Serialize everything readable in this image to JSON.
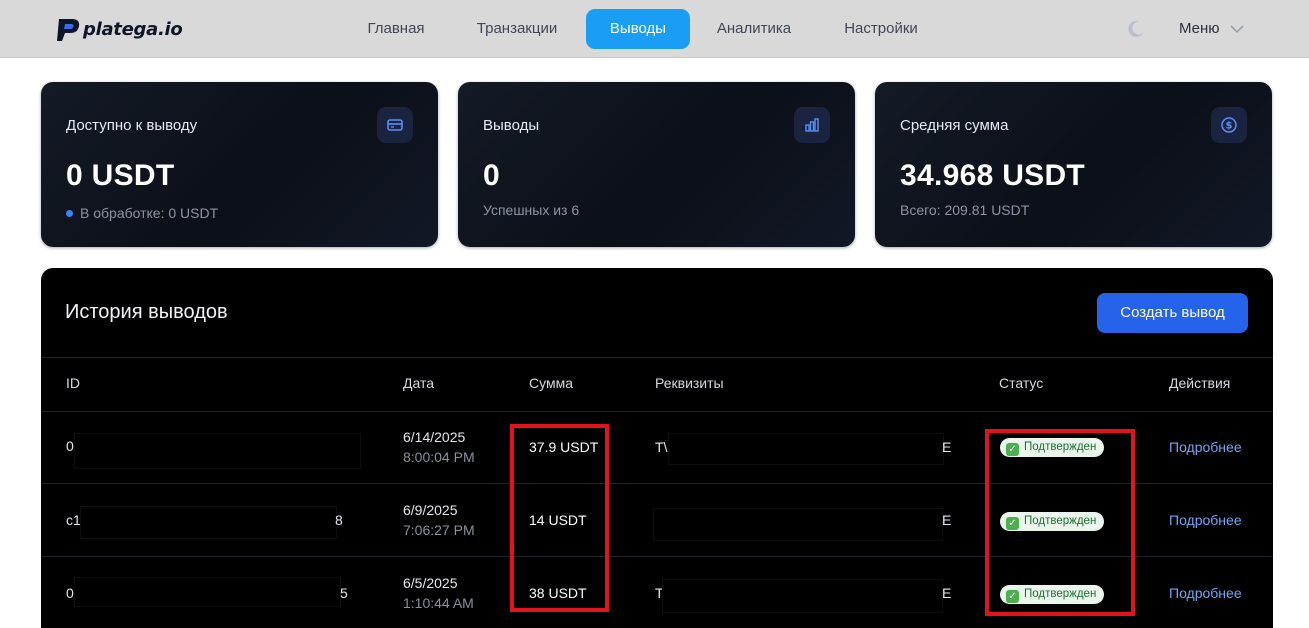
{
  "brand": {
    "logo_text": "platega.io"
  },
  "nav": {
    "items": [
      {
        "label": "Главная",
        "active": false
      },
      {
        "label": "Транзакции",
        "active": false
      },
      {
        "label": "Выводы",
        "active": true
      },
      {
        "label": "Аналитика",
        "active": false
      },
      {
        "label": "Настройки",
        "active": false
      }
    ],
    "menu_label": "Меню",
    "theme_icon": "moon-icon"
  },
  "stats": [
    {
      "title": "Доступно к выводу",
      "value": "0 USDT",
      "sub": "В обработке: 0 USDT",
      "icon": "credit-card-icon"
    },
    {
      "title": "Выводы",
      "value": "0",
      "sub": "Успешных из 6",
      "icon": "bar-chart-icon"
    },
    {
      "title": "Средняя сумма",
      "value": "34.968 USDT",
      "sub": "Всего: 209.81 USDT",
      "icon": "dollar-circle-icon"
    }
  ],
  "history": {
    "title": "История выводов",
    "create_button": "Создать вывод",
    "columns": [
      "ID",
      "Дата",
      "Сумма",
      "Реквизиты",
      "Статус",
      "Действия"
    ],
    "rows": [
      {
        "id_start": "0",
        "id_end": "",
        "date": "6/14/2025",
        "time": "8:00:04 PM",
        "amount": "37.9 USDT",
        "req_start": "T\\",
        "req_end": "E",
        "status": "Подтвержден",
        "action": "Подробнее"
      },
      {
        "id_start": "c1",
        "id_end": "8",
        "date": "6/9/2025",
        "time": "7:06:27 PM",
        "amount": "14 USDT",
        "req_start": "",
        "req_end": "E",
        "status": "Подтвержден",
        "action": "Подробнее"
      },
      {
        "id_start": "0",
        "id_end": "5",
        "date": "6/5/2025",
        "time": "1:10:44 AM",
        "amount": "38 USDT",
        "req_start": "T",
        "req_end": "E",
        "status": "Подтвержден",
        "action": "Подробнее"
      }
    ]
  },
  "colors": {
    "accent": "#2563eb",
    "nav_active": "#1a9ef5",
    "highlight": "#e0141c",
    "status_bg": "#eaf6ec"
  }
}
